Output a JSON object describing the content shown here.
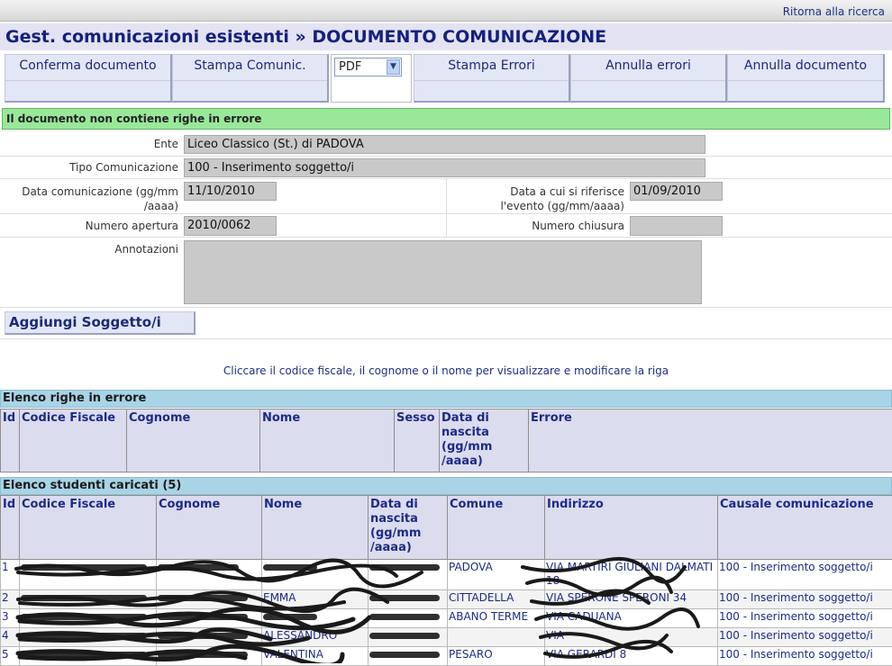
{
  "topbar": {
    "back_link": "Ritorna alla ricerca"
  },
  "title": "Gest. comunicazioni esistenti » DOCUMENTO COMUNICAZIONE",
  "toolbar": {
    "confirm": "Conferma documento",
    "print": "Stampa Comunic.",
    "format": "PDF",
    "print_errors": "Stampa Errori",
    "cancel_errors": "Annulla errori",
    "cancel_doc": "Annulla documento"
  },
  "status_message": "Il documento non contiene righe in errore",
  "form": {
    "ente": {
      "label": "Ente",
      "value": "Liceo Classico  (St.)   di PADOVA"
    },
    "tipo": {
      "label": "Tipo Comunicazione",
      "value": "100 - Inserimento soggetto/i"
    },
    "data_com": {
      "label_1": "Data comunicazione (gg/mm",
      "label_2": "/aaaa)",
      "value": "11/10/2010"
    },
    "data_evento": {
      "label_1": "Data a cui si riferisce",
      "label_2": "l'evento (gg/mm/aaaa)",
      "value": "01/09/2010"
    },
    "num_apertura": {
      "label": "Numero apertura",
      "value": "2010/0062"
    },
    "num_chiusura": {
      "label": "Numero chiusura",
      "value": ""
    },
    "annotazioni": {
      "label": "Annotazioni",
      "value": ""
    }
  },
  "add_button": "Aggiungi Soggetto/i",
  "hint": "Cliccare il codice fiscale, il cognome o il nome per visualizzare e modificare la riga",
  "errors_table": {
    "title": "Elenco righe in errore",
    "headers": [
      "Id",
      "Codice Fiscale",
      "Cognome",
      "Nome",
      "Sesso",
      "Data di nascita (gg/mm /aaaa)",
      "Errore"
    ]
  },
  "students_table": {
    "title": "Elenco studenti caricati (5)",
    "headers": [
      "Id",
      "Codice Fiscale",
      "Cognome",
      "Nome",
      "Data di nascita (gg/mm /aaaa)",
      "Comune",
      "Indirizzo",
      "Causale comunicazione"
    ],
    "rows": [
      {
        "id": "1",
        "nome": "",
        "comune": "PADOVA",
        "indirizzo": "VIA MARTIRI GIULIANI DALMATI 18",
        "causale": "100 - Inserimento soggetto/i"
      },
      {
        "id": "2",
        "nome": "EMMA",
        "comune": "CITTADELLA",
        "indirizzo": "VIA SPERONE SPERONI 34",
        "causale": "100 - Inserimento soggetto/i"
      },
      {
        "id": "3",
        "nome": "",
        "comune": "ABANO TERME",
        "indirizzo": "VIA CADUANA",
        "causale": "100 - Inserimento soggetto/i"
      },
      {
        "id": "4",
        "nome": "ALESSANDRO",
        "comune": "",
        "indirizzo": "VIA",
        "causale": "100 - Inserimento soggetto/i"
      },
      {
        "id": "5",
        "nome": "VALENTINA",
        "comune": "PESARO",
        "indirizzo": "VIA GERARDI 8",
        "causale": "100 - Inserimento soggetto/i"
      }
    ]
  }
}
